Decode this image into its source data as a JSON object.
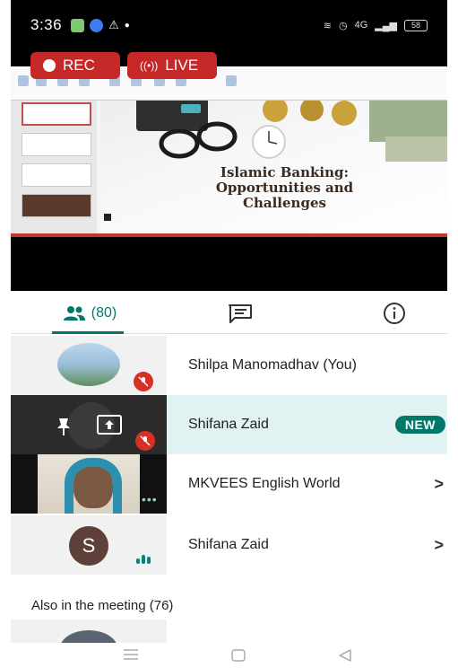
{
  "status_bar": {
    "time": "3:36",
    "right_text": "4G",
    "battery": "58"
  },
  "call": {
    "rec_label": "REC",
    "live_label": "LIVE"
  },
  "slide": {
    "title_line1": "Islamic Banking:",
    "title_line2": "Opportunities and",
    "title_line3": "Challenges"
  },
  "tabs": {
    "people_count": "(80)",
    "active": "people"
  },
  "participants": [
    {
      "name": "Shilpa Manomadhav (You)",
      "muted": true,
      "chevron": ""
    },
    {
      "name": "Shifana Zaid",
      "badge": "NEW",
      "muted": true
    },
    {
      "name": "MKVEES English World",
      "chevron": ">"
    },
    {
      "name": "Shifana Zaid",
      "avatar_letter": "S",
      "chevron": ">"
    }
  ],
  "also_in_meeting": "Also in the meeting (76)",
  "colors": {
    "accent": "#00796b",
    "live_red": "#c62828",
    "mute_red": "#d93025",
    "selected_row_bg": "#e0f2f1"
  },
  "icons": {
    "people_tab": "people-icon",
    "chat_tab": "chat-icon",
    "info_tab": "info-icon"
  }
}
